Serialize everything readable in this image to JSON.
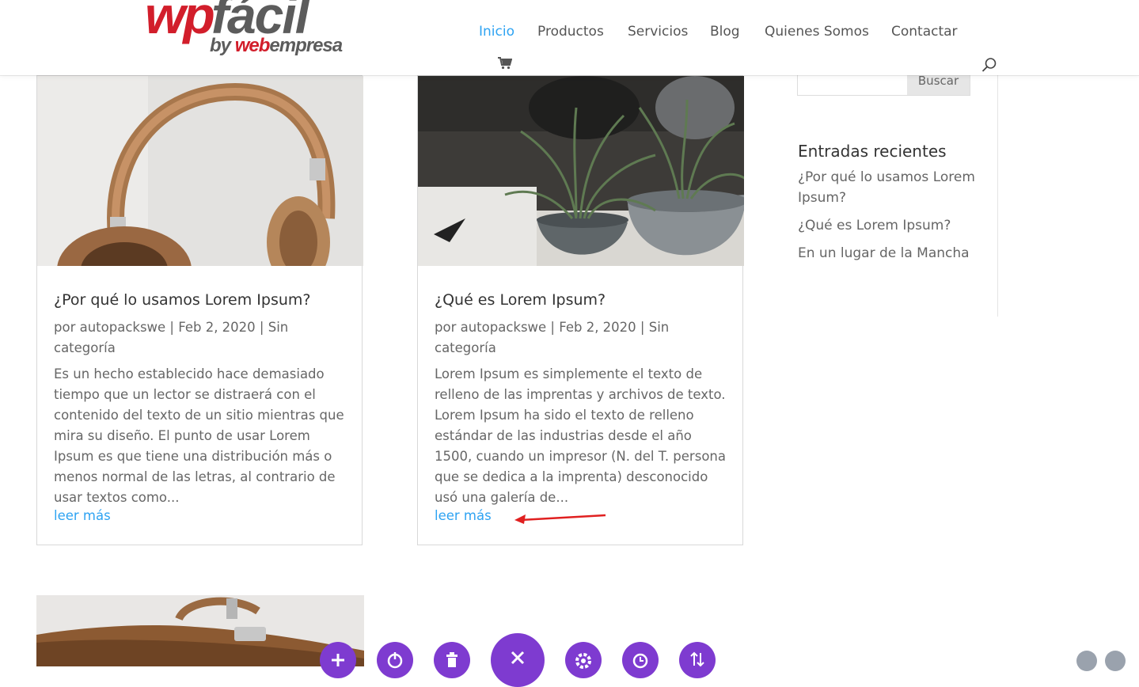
{
  "header": {
    "logo": {
      "main_red": "wp",
      "main_gray": "fácil",
      "by": "by",
      "brand_red": "web",
      "brand_gray": "empresa"
    },
    "nav": [
      {
        "label": "Inicio",
        "active": true
      },
      {
        "label": "Productos",
        "active": false
      },
      {
        "label": "Servicios",
        "active": false
      },
      {
        "label": "Blog",
        "active": false
      },
      {
        "label": "Quienes Somos",
        "active": false
      },
      {
        "label": "Contactar",
        "active": false
      }
    ],
    "icons": [
      "cart-icon",
      "search-icon"
    ]
  },
  "posts": [
    {
      "title": "¿Por qué lo usamos Lorem Ipsum?",
      "meta": "por autopackswe | Feb 2, 2020 | Sin categoría",
      "excerpt": "Es un hecho establecido hace demasiado tiempo que un lector se distraerá con el contenido del texto de un sitio mientras que mira su diseño. El punto de usar Lorem Ipsum es que tiene una distribución más o menos normal de las letras, al contrario de usar textos como...",
      "more": "leer más",
      "image": "headphones"
    },
    {
      "title": "¿Qué es Lorem Ipsum?",
      "meta": "por autopackswe | Feb 2, 2020 | Sin categoría",
      "excerpt": "Lorem Ipsum es simplemente el texto de relleno de las imprentas y archivos de texto. Lorem Ipsum ha sido el texto de relleno estándar de las industrias desde el año 1500, cuando un impresor (N. del T. persona que se dedica a la imprenta) desconocido usó una galería de...",
      "more": "leer más",
      "image": "plants"
    }
  ],
  "sidebar": {
    "search_button": "Buscar",
    "recent_title": "Entradas recientes",
    "recent": [
      "¿Por qué lo usamos Lorem Ipsum?",
      "¿Qué es Lorem Ipsum?",
      "En un lugar de la Mancha"
    ]
  },
  "builder_bar": {
    "buttons": [
      "add-icon",
      "power-icon",
      "trash-icon",
      "close-icon",
      "settings-icon",
      "history-icon",
      "sort-icon"
    ],
    "color": "#7e3bd0"
  },
  "colors": {
    "accent": "#2ea3f2",
    "logo_red": "#d21e2b",
    "annotation_arrow": "#e02020"
  }
}
